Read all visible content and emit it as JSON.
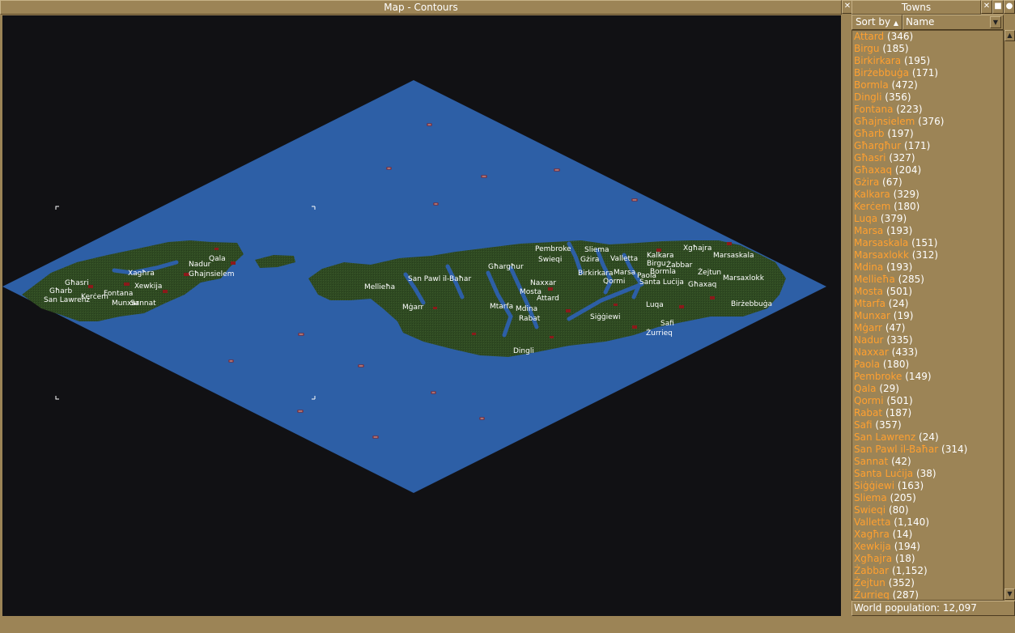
{
  "map_window": {
    "title": "Map - Contours",
    "close_icon": "close-icon",
    "colors": {
      "sea": "#2d5fa6",
      "land": "#2f4a22",
      "background": "#111114",
      "town": "#8b1a1a"
    }
  },
  "towns_window": {
    "title": "Towns",
    "sort_button": "Sort by",
    "sort_arrow": "▲",
    "sort_value": "Name",
    "dropdown_icon": "▼",
    "status": "World population: 12,097",
    "towns": [
      {
        "name": "Attard",
        "pop": "(346)"
      },
      {
        "name": "Birgu",
        "pop": "(185)"
      },
      {
        "name": "Birkirkara",
        "pop": "(195)"
      },
      {
        "name": "Birżebbuġa",
        "pop": "(171)"
      },
      {
        "name": "Bormla",
        "pop": "(472)"
      },
      {
        "name": "Dingli",
        "pop": "(356)"
      },
      {
        "name": "Fontana",
        "pop": "(223)"
      },
      {
        "name": "Għajnsielem",
        "pop": "(376)"
      },
      {
        "name": "Għarb",
        "pop": "(197)"
      },
      {
        "name": "Għargħur",
        "pop": "(171)"
      },
      {
        "name": "Għasri",
        "pop": "(327)"
      },
      {
        "name": "Għaxaq",
        "pop": "(204)"
      },
      {
        "name": "Gżira",
        "pop": "(67)"
      },
      {
        "name": "Kalkara",
        "pop": "(329)"
      },
      {
        "name": "Kerċem",
        "pop": "(180)"
      },
      {
        "name": "Luqa",
        "pop": "(379)"
      },
      {
        "name": "Marsa",
        "pop": "(193)"
      },
      {
        "name": "Marsaskala",
        "pop": "(151)"
      },
      {
        "name": "Marsaxlokk",
        "pop": "(312)"
      },
      {
        "name": "Mdina",
        "pop": "(193)"
      },
      {
        "name": "Mellieħa",
        "pop": "(285)"
      },
      {
        "name": "Mosta",
        "pop": "(501)"
      },
      {
        "name": "Mtarfa",
        "pop": "(24)"
      },
      {
        "name": "Munxar",
        "pop": "(19)"
      },
      {
        "name": "Mġarr",
        "pop": "(47)"
      },
      {
        "name": "Nadur",
        "pop": "(335)"
      },
      {
        "name": "Naxxar",
        "pop": "(433)"
      },
      {
        "name": "Paola",
        "pop": "(180)"
      },
      {
        "name": "Pembroke",
        "pop": "(149)"
      },
      {
        "name": "Qala",
        "pop": "(29)"
      },
      {
        "name": "Qormi",
        "pop": "(501)"
      },
      {
        "name": "Rabat",
        "pop": "(187)"
      },
      {
        "name": "Safi",
        "pop": "(357)"
      },
      {
        "name": "San Lawrenz",
        "pop": "(24)"
      },
      {
        "name": "San Pawl il-Baħar",
        "pop": "(314)"
      },
      {
        "name": "Sannat",
        "pop": "(42)"
      },
      {
        "name": "Santa Luċija",
        "pop": "(38)"
      },
      {
        "name": "Siġġiewi",
        "pop": "(163)"
      },
      {
        "name": "Sliema",
        "pop": "(205)"
      },
      {
        "name": "Swieqi",
        "pop": "(80)"
      },
      {
        "name": "Valletta",
        "pop": "(1,140)"
      },
      {
        "name": "Xagħra",
        "pop": "(14)"
      },
      {
        "name": "Xewkija",
        "pop": "(194)"
      },
      {
        "name": "Xgħajra",
        "pop": "(18)"
      },
      {
        "name": "Żabbar",
        "pop": "(1,152)"
      },
      {
        "name": "Żejtun",
        "pop": "(352)"
      },
      {
        "name": "Żurrieq",
        "pop": "(287)"
      }
    ]
  },
  "map_labels": {
    "nadur": "Nadur",
    "qala": "Qala",
    "xaghra": "Xagħra",
    "ghajnsielem": "Għajnsielem",
    "ghasri": "Għasri",
    "gharb": "Għarb",
    "xewkija": "Xewkija",
    "fontana": "Fontana",
    "kercem": "Kerċem",
    "san_lawrenz": "San Lawrenz",
    "munxar": "Munxar",
    "sannat": "Sannat",
    "mellieha": "Mellieħa",
    "san_pawl": "San Pawl il-Baħar",
    "mgarr": "Mġarr",
    "ghargħur": "Għargħur",
    "pembroke": "Pembroke",
    "swieqi": "Swieqi",
    "sliema": "Sliema",
    "gzira": "Gżira",
    "valletta": "Valletta",
    "birkirkara": "Birkirkara",
    "naxxar": "Naxxar",
    "mosta": "Mosta",
    "attard": "Attard",
    "mtarfa": "Mtarfa",
    "mdina": "Mdina",
    "rabat": "Rabat",
    "dingli": "Dingli",
    "siggiewi": "Siġġiewi",
    "marsa": "Marsa",
    "qormi": "Qormi",
    "kalkara": "Kalkara",
    "birgu": "Birgu",
    "bormla": "Bormla",
    "zabbar": "Żabbar",
    "paola": "Paola",
    "santa_lucija": "Santa Luċija",
    "xghajra": "Xgħajra",
    "marsaskala": "Marsaskala",
    "zejtun": "Żejtun",
    "ghaxaq": "Għaxaq",
    "marsaxlokk": "Marsaxlokk",
    "luqa": "Luqa",
    "safi": "Safi",
    "zurrieq": "Żurrieq",
    "birzebbuga": "Birżebbuġa"
  }
}
